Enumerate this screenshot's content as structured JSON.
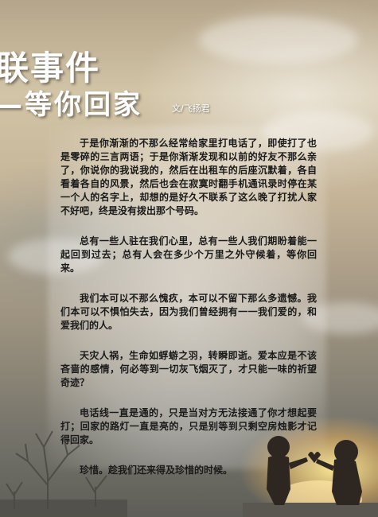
{
  "title": {
    "line1": "联事件",
    "line2": "—等你回家"
  },
  "byline": "文/飞扬君",
  "paragraphs": [
    "于是你渐渐的不那么经常给家里打电话了，即使打了也是零碎的三言两语；于是你渐渐发现和以前的好友不那么亲了，你说你的我说我的，然后在出租车的后座沉默着，各自看着各自的风景，然后也会在寂寞时翻手机通讯录时停在某一个人的名字上，却想的是好久不联系了这么晚了打扰人家不好吧，终是没有拨出那个号码。",
    "总有一些人驻在我们心里，总有一些人我们期盼着能一起回到过去；总有人会在多少个万里之外守候着，等你回来。",
    "我们本可以不那么愧疚，本可以不留下那么多遗憾。我们本可以不惧怕失去，因为我们曾经拥有一一我们爱的，和爱我们的人。",
    "天灾人祸，生命如蜉蝣之羽，转瞬即逝。爱本应是不该吝啬的感情，何必等到一切灰飞烟灭了，才只能一味的祈望奇迹？",
    "电话线一直是通的，只是当对方无法接通了你才想起要打；回家的路灯一直是亮的，只是别等到只剩空房烛影才记得回家。",
    "珍惜。趁我们还来得及珍惜的时候。"
  ],
  "colors": {
    "title": "#ffffff",
    "body_text": "#1a1a1a",
    "sunset": "#ffd98a"
  }
}
